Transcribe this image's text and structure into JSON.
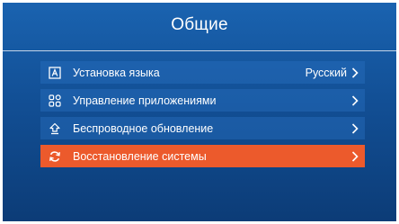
{
  "screen": {
    "title": "Общие"
  },
  "menu": {
    "items": [
      {
        "label": "Установка языка",
        "value": "Русский",
        "icon": "language-icon",
        "selected": false
      },
      {
        "label": "Управление приложениями",
        "value": "",
        "icon": "apps-grid-icon",
        "selected": false
      },
      {
        "label": "Беспроводное обновление",
        "value": "",
        "icon": "update-arrow-icon",
        "selected": false
      },
      {
        "label": "Восстановление системы",
        "value": "",
        "icon": "refresh-icon",
        "selected": true
      }
    ]
  },
  "colors": {
    "background_top": "#1a63b0",
    "background_bottom": "#0c3c77",
    "item_background": "#2c6db4",
    "selected_accent": "#ec5a2c",
    "text": "#ffffff"
  }
}
